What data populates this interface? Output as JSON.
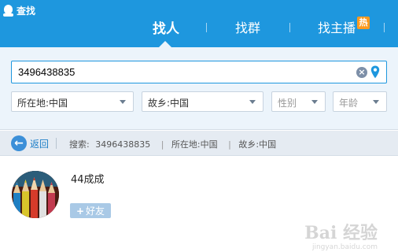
{
  "header": {
    "app_title": "查找",
    "tabs": [
      {
        "label": "找人",
        "active": true
      },
      {
        "label": "找群",
        "active": false
      },
      {
        "label": "找主播",
        "active": false,
        "badge": "热"
      }
    ]
  },
  "search": {
    "value": "3496438835",
    "filters": [
      {
        "label": "所在地:中国",
        "placeholder": false
      },
      {
        "label": "故乡:中国",
        "placeholder": false
      },
      {
        "label": "性别",
        "placeholder": true
      },
      {
        "label": "年龄",
        "placeholder": true
      }
    ]
  },
  "breadcrumb": {
    "back_label": "返回",
    "search_label": "搜索:",
    "search_value": "3496438835",
    "location": "所在地:中国",
    "hometown": "故乡:中国"
  },
  "result": {
    "name": "44成成",
    "add_label": "好友",
    "add_icon": "+"
  },
  "watermark": {
    "brand": "Bai 经验",
    "url": "jingyan.baidu.com"
  },
  "colors": {
    "header_bg": "#1e97de",
    "panel_bg": "#ecf4fb",
    "hot_badge": "#ff9a1f",
    "add_button": "#a9c9e6"
  }
}
